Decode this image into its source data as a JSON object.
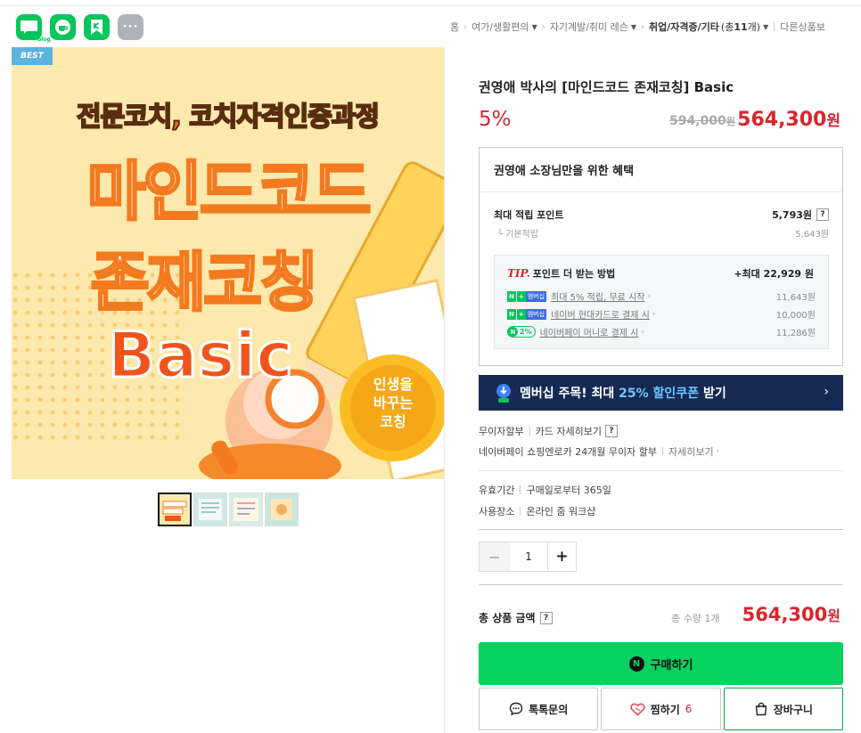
{
  "share": [
    {
      "name": "blog",
      "label": "blog",
      "color": "#03c75a"
    },
    {
      "name": "cafe",
      "label": "",
      "color": "#03c75a"
    },
    {
      "name": "band",
      "label": "",
      "color": "#03c75a"
    },
    {
      "name": "more",
      "label": "···",
      "color": "#aeb3bb"
    }
  ],
  "breadcrumb": {
    "home": "홈",
    "cat1": "여가/생활편의",
    "cat2": "자기계발/취미 레슨",
    "cat3": "취업/자격증/기타",
    "count_prefix": "(총 ",
    "count": "11",
    "count_suffix": "개)",
    "other": "다른상품보"
  },
  "product": {
    "badge": "BEST",
    "image": {
      "line1": "전문코치, 코치자격인증과정",
      "line2": "마인드코드",
      "line3": "존재코칭",
      "line4": "Basic",
      "seal1": "인생을",
      "seal2": "바꾸는",
      "seal3": "코칭"
    },
    "title": "권영애 박사의 [마인드코드 존재코칭] Basic",
    "discount": "5%",
    "original_price": "594,000",
    "original_unit": "원",
    "sale_price": "564,300",
    "sale_unit": "원"
  },
  "benefit": {
    "header": "권영애 소장님만을 위한 혜택",
    "max_point_label": "최대 적립 포인트",
    "max_point_value": "5,793원",
    "q": "?",
    "basic_label": "└ 기본적립",
    "basic_value": "5,643원",
    "tip_label": "TIP.",
    "tip_title": "포인트 더 받는 방법",
    "tip_max": "+최대 22,929 원",
    "tips": [
      {
        "badge_n": "N",
        "badge_plus": "+",
        "badge_mem": "멤버십",
        "text": "최대 5% 적립, 무료 시작",
        "amount": "11,643원"
      },
      {
        "badge_n": "N",
        "badge_plus": "+",
        "badge_mem": "멤버십",
        "text": "네이버 현대카드로 결제 시",
        "amount": "10,000원"
      },
      {
        "badge_pay": "2%",
        "badge_circ": "N",
        "text": "네이버페이 머니로 결제 시",
        "amount": "11,286원"
      }
    ]
  },
  "member_banner": {
    "prefix": "멤버십 주목! 최대 ",
    "highlight": "25% 할인쿠폰",
    "suffix": " 받기",
    "chevron": "›"
  },
  "installment": {
    "line1_a": "무이자할부",
    "line1_b": "카드 자세히보기",
    "line2_a": "네이버페이 쇼핑엔로카 24개월 무이자 할부",
    "line2_b": "자세히보기"
  },
  "validity": {
    "period_label": "유효기간",
    "period_value": "구매일로부터 365일",
    "place_label": "사용장소",
    "place_value": "온라인 줌 워크샵"
  },
  "quantity": {
    "minus": "−",
    "value": "1",
    "plus": "+"
  },
  "total": {
    "label": "총 상품 금액",
    "qty": "총 수량 1개",
    "price": "564,300",
    "unit": "원"
  },
  "buttons": {
    "buy": "구매하기",
    "buy_logo": "N",
    "talk": "톡톡문의",
    "zzim": "찜하기",
    "zzim_count": "6",
    "cart": "장바구니"
  },
  "colors": {
    "accent_red": "#d8262f",
    "naver_green": "#03c75a",
    "banner_navy": "#152952"
  }
}
